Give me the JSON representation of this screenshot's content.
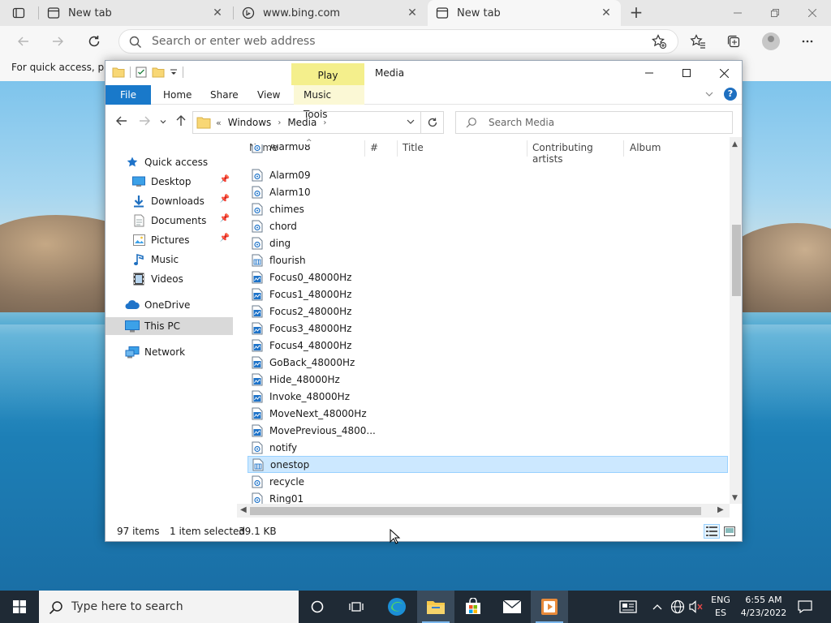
{
  "browser": {
    "tabs": [
      {
        "title": "New tab",
        "close": "✕"
      },
      {
        "title": "www.bing.com",
        "close": "✕"
      },
      {
        "title": "New tab",
        "close": "✕"
      }
    ],
    "new_tab": "+",
    "address_placeholder": "Search or enter web address",
    "favorites_bar_text": "For quick access, plac"
  },
  "explorer": {
    "context_tab": "Play",
    "title": "Media",
    "ribbon_tabs": [
      "File",
      "Home",
      "Share",
      "View",
      "Music Tools"
    ],
    "path": [
      "«",
      "Windows",
      "Media"
    ],
    "search_placeholder": "Search Media",
    "nav": {
      "quick_access": "Quick access",
      "desktop": "Desktop",
      "downloads": "Downloads",
      "documents": "Documents",
      "pictures": "Pictures",
      "music": "Music",
      "videos": "Videos",
      "onedrive": "OneDrive",
      "this_pc": "This PC",
      "network": "Network"
    },
    "columns": [
      "Name",
      "#",
      "Title",
      "Contributing artists",
      "Album"
    ],
    "files": [
      {
        "name": "Alarm08",
        "icon": "audio-icon"
      },
      {
        "name": "Alarm09",
        "icon": "audio-icon"
      },
      {
        "name": "Alarm10",
        "icon": "audio-icon"
      },
      {
        "name": "chimes",
        "icon": "audio-icon"
      },
      {
        "name": "chord",
        "icon": "audio-icon"
      },
      {
        "name": "ding",
        "icon": "audio-icon"
      },
      {
        "name": "flourish",
        "icon": "midi-icon"
      },
      {
        "name": "Focus0_48000Hz",
        "icon": "wave-icon"
      },
      {
        "name": "Focus1_48000Hz",
        "icon": "wave-icon"
      },
      {
        "name": "Focus2_48000Hz",
        "icon": "wave-icon"
      },
      {
        "name": "Focus3_48000Hz",
        "icon": "wave-icon"
      },
      {
        "name": "Focus4_48000Hz",
        "icon": "wave-icon"
      },
      {
        "name": "GoBack_48000Hz",
        "icon": "wave-icon"
      },
      {
        "name": "Hide_48000Hz",
        "icon": "wave-icon"
      },
      {
        "name": "Invoke_48000Hz",
        "icon": "wave-icon"
      },
      {
        "name": "MoveNext_48000Hz",
        "icon": "wave-icon"
      },
      {
        "name": "MovePrevious_4800...",
        "icon": "wave-icon"
      },
      {
        "name": "notify",
        "icon": "audio-icon"
      },
      {
        "name": "onestop",
        "icon": "midi-icon"
      },
      {
        "name": "recycle",
        "icon": "audio-icon"
      },
      {
        "name": "Ring01",
        "icon": "audio-icon"
      }
    ],
    "selected_file": "onestop",
    "status": {
      "items": "97 items",
      "selected": "1 item selected",
      "size": "39.1 KB"
    }
  },
  "taskbar": {
    "search_placeholder": "Type here to search",
    "lang_1": "ENG",
    "lang_2": "ES",
    "time": "6:55 AM",
    "date": "4/23/2022"
  },
  "colors": {
    "accent": "#1979ca",
    "selection": "#cce8ff",
    "context_tab": "#f4ef8c",
    "taskbar": "#1f2a35"
  }
}
